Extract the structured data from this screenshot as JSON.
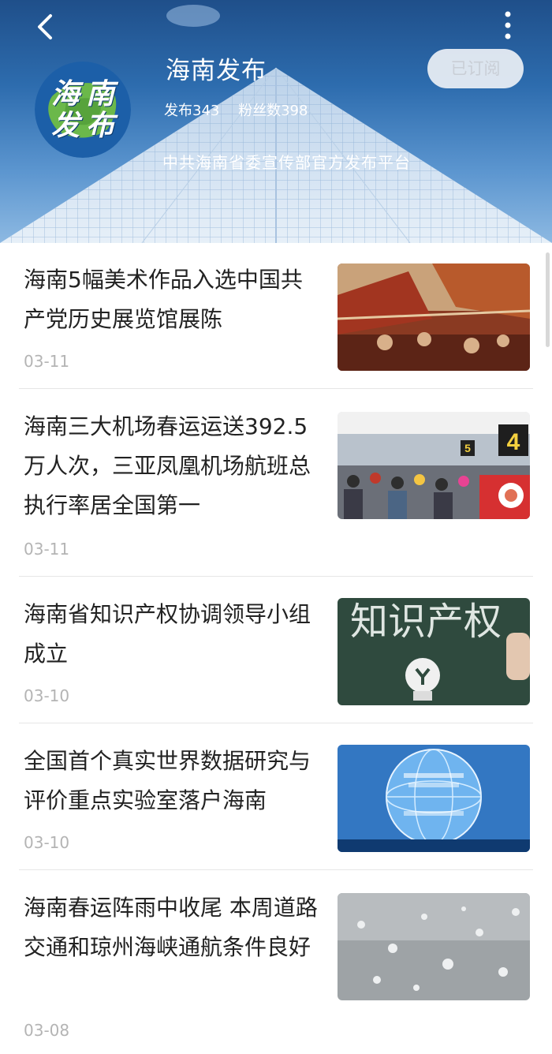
{
  "header": {
    "name": "海南发布",
    "posts": "发布343",
    "fans": "粉丝数398",
    "description": "中共海南省委宣传部官方发布平台",
    "subscribe_label": "已订阅",
    "avatar_chars": [
      "海",
      "南",
      "发",
      "布"
    ],
    "icons": {
      "back": "chevron-left-icon",
      "more": "more-vertical-icon"
    }
  },
  "feed": {
    "items": [
      {
        "title": "海南5幅美术作品入选中国共产党历史展览馆展陈",
        "date": "03-11",
        "thumb": "artwork-painting"
      },
      {
        "title": "海南三大机场春运运送392.5万人次，三亚凤凰机场航班总执行率居全国第一",
        "date": "03-11",
        "thumb": "airport-crowd"
      },
      {
        "title": "海南省知识产权协调领导小组成立",
        "date": "03-10",
        "thumb": "chalkboard-ip"
      },
      {
        "title": "全国首个真实世界数据研究与评价重点实验室落户海南",
        "date": "03-10",
        "thumb": "data-globe"
      },
      {
        "title": "海南春运阵雨中收尾 本周道路交通和琼州海峡通航条件良好",
        "date": "03-08",
        "thumb": "rain-glass"
      }
    ]
  },
  "colors": {
    "header": "#2d6cae",
    "title": "#222222",
    "date": "#b4b4b4",
    "chalkboard": "#2f4a3e"
  },
  "thumb_overlays": {
    "chalkboard": "知识产权",
    "gate_a": "5",
    "gate_b": "4"
  }
}
